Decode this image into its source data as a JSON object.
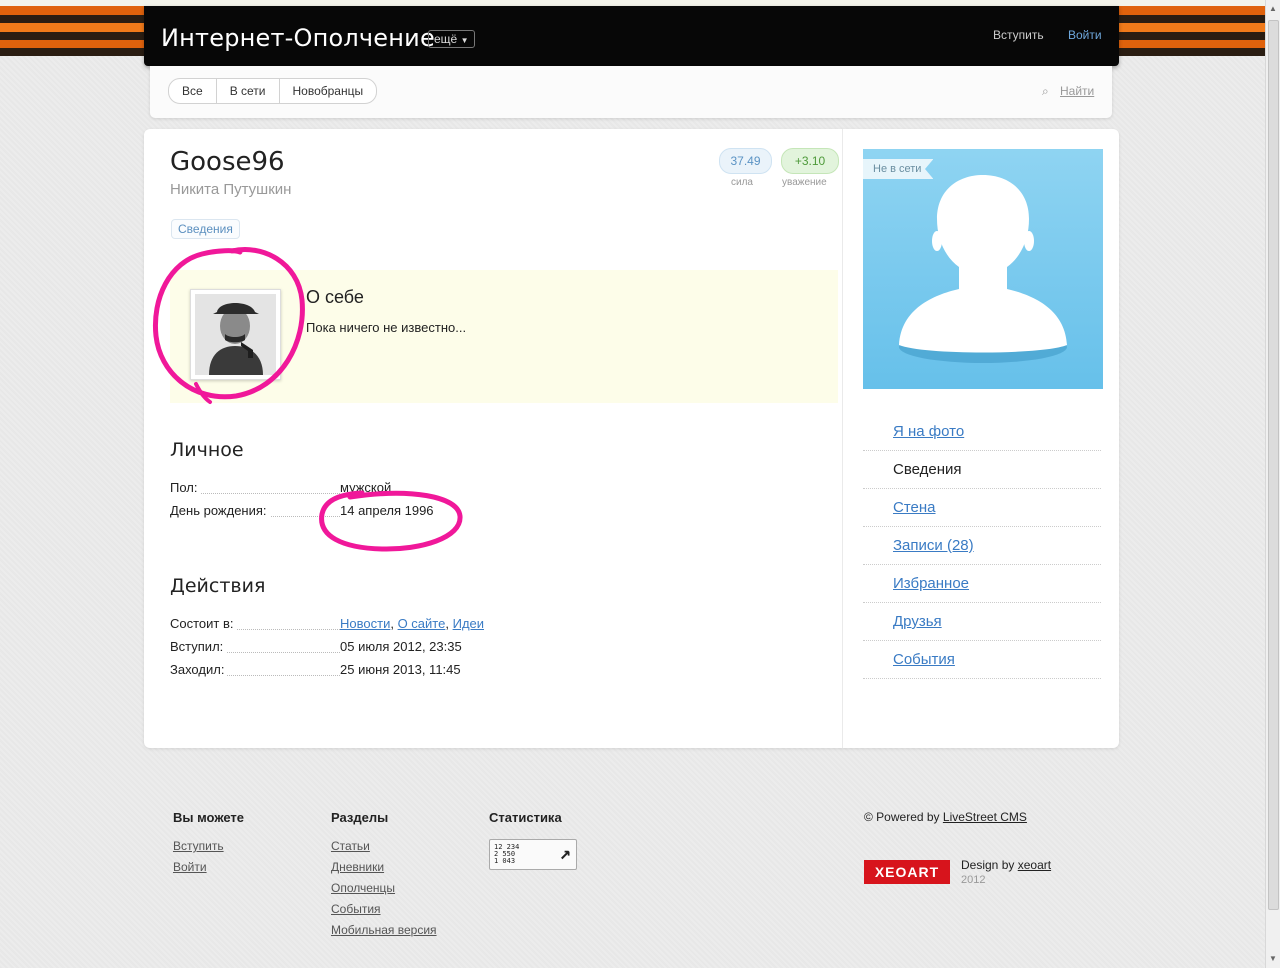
{
  "header": {
    "site_title": "Интернет-Ополчение",
    "more_label": "ещё",
    "join_label": "Вступить",
    "login_label": "Войти"
  },
  "subnav": {
    "tabs": [
      "Все",
      "В сети",
      "Новобранцы"
    ],
    "search_label": "Найти"
  },
  "profile": {
    "login": "Goose96",
    "real_name": "Никита Путушкин",
    "strength_value": "37.49",
    "strength_label": "сила",
    "rating_value": "+3.10",
    "rating_label": "уважение",
    "tag_label": "Сведения",
    "about_title": "О себе",
    "about_text": "Пока ничего не известно...",
    "status": "Не в сети"
  },
  "personal": {
    "title": "Личное",
    "rows": [
      {
        "label": "Пол:",
        "value": "мужской"
      },
      {
        "label": "День рождения:",
        "value": "14 апреля 1996"
      }
    ]
  },
  "actions": {
    "title": "Действия",
    "member_label": "Состоит в:",
    "member_links": [
      "Новости",
      "О сайте",
      "Идеи"
    ],
    "separator": ",",
    "joined_label": "Вступил:",
    "joined_value": "05 июля 2012, 23:35",
    "visited_label": "Заходил:",
    "visited_value": "25 июня 2013, 11:45"
  },
  "sidebar_menu": [
    {
      "label": "Я на фото"
    },
    {
      "label": "Сведения"
    },
    {
      "label": "Стена"
    },
    {
      "label": "Записи (28)"
    },
    {
      "label": "Избранное"
    },
    {
      "label": "Друзья"
    },
    {
      "label": "События"
    }
  ],
  "footer": {
    "col1": {
      "title": "Вы можете",
      "links": [
        "Вступить",
        "Войти"
      ]
    },
    "col2": {
      "title": "Разделы",
      "links": [
        "Статьи",
        "Дневники",
        "Ополченцы",
        "События",
        "Мобильная версия"
      ]
    },
    "col3": {
      "title": "Статистика",
      "counter": [
        "12 234",
        "2 550",
        "1 043"
      ]
    },
    "powered_prefix": "© Powered by",
    "powered_link": "LiveStreet CMS",
    "xeo_logo_text": "XEOART",
    "design_prefix": "Design by",
    "design_link": "xeoart",
    "year": "2012"
  },
  "colors": {
    "accent_link": "#3a7bc4",
    "annotation_pink": "#f0189a",
    "header_bg": "#070707",
    "ribbon_orange": "#e0620c",
    "ribbon_black": "#2a1d12"
  }
}
